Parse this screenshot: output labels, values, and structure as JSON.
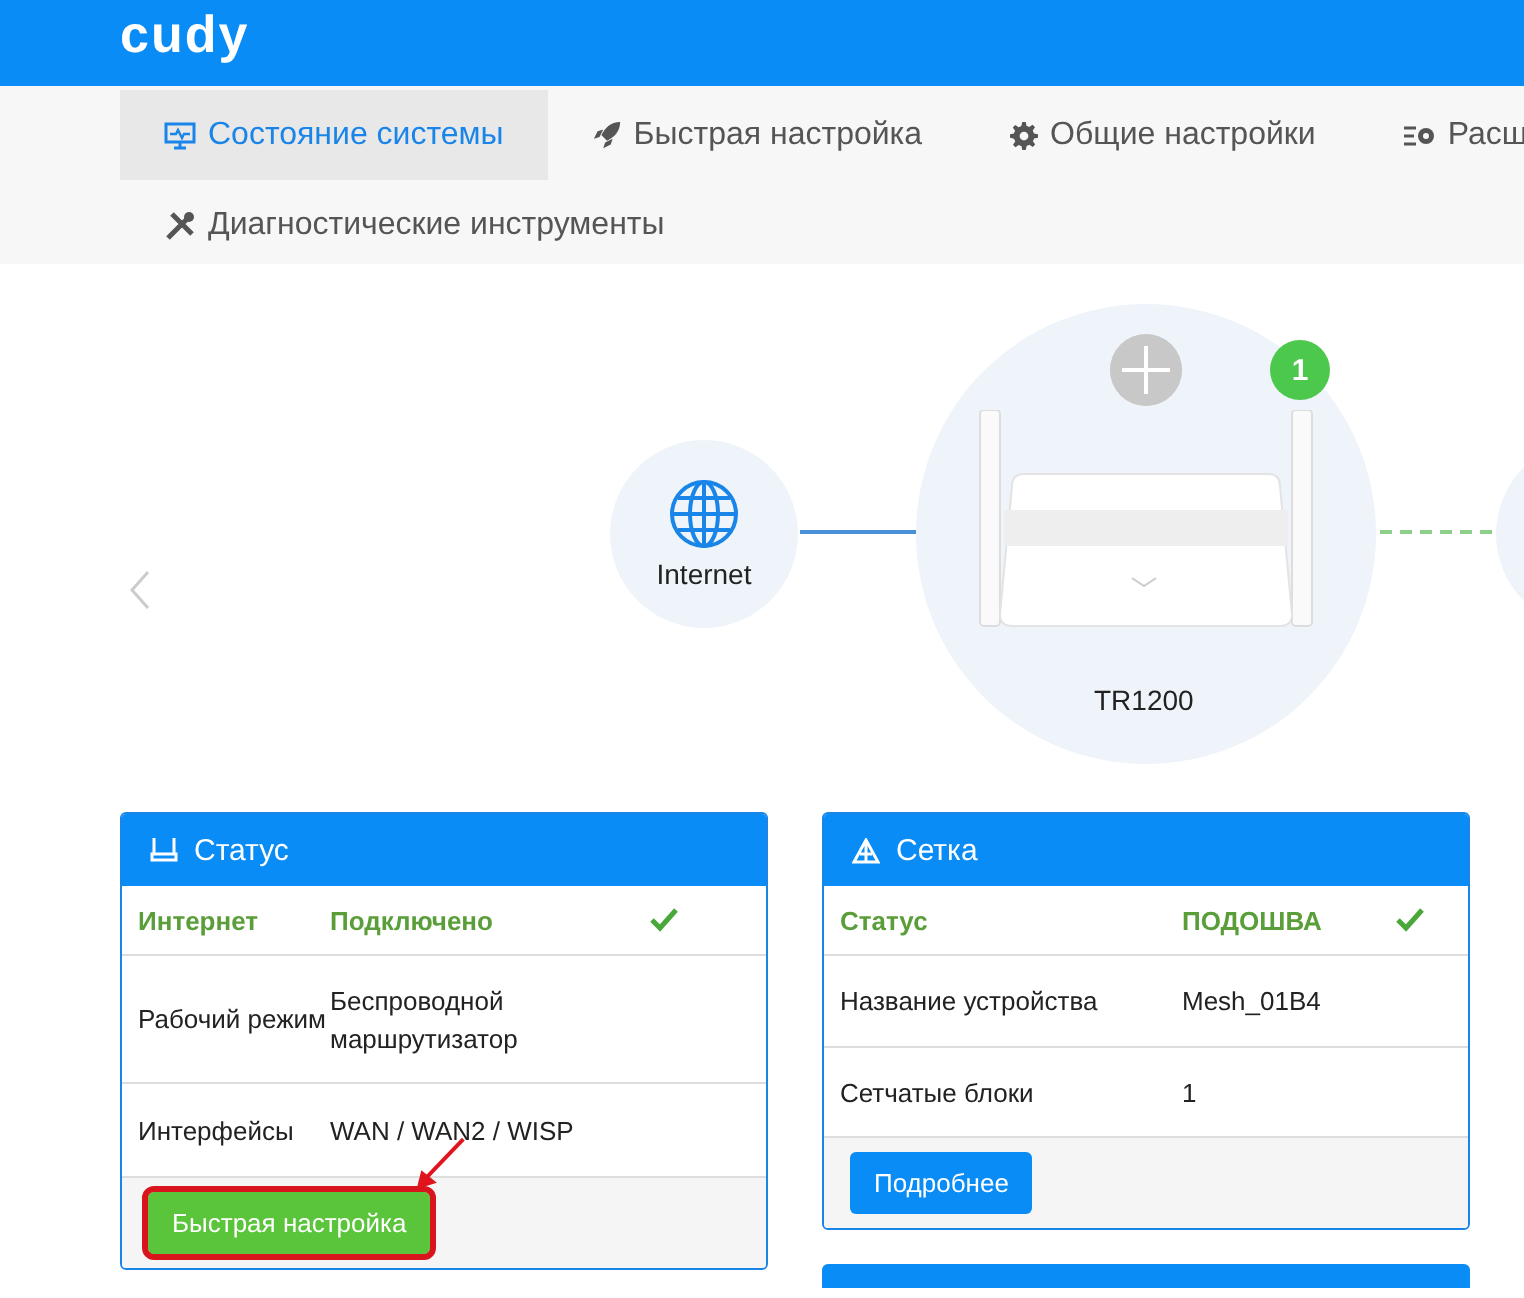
{
  "header": {
    "logo": "cudy"
  },
  "nav": {
    "tabs": [
      {
        "label": "Состояние системы",
        "selected": true
      },
      {
        "label": "Быстрая настройка",
        "selected": false
      },
      {
        "label": "Общие настройки",
        "selected": false
      },
      {
        "label": "Расш",
        "selected": false
      },
      {
        "label": "Диагностические инструменты",
        "selected": false
      }
    ]
  },
  "topology": {
    "internet": {
      "label": "Internet"
    },
    "router": {
      "label": "TR1200",
      "badge": "1"
    }
  },
  "cards": [
    {
      "title": "Статус",
      "rows": [
        {
          "label": "Интернет",
          "value": "Подключено",
          "ok": true
        },
        {
          "label": "Рабочий режим",
          "value": "Беспроводной маршрутизатор",
          "ok": false
        },
        {
          "label": "Интерфейсы",
          "value": "WAN / WAN2 / WISP",
          "ok": false
        }
      ],
      "button": {
        "label": "Быстрая настройка",
        "kind": "success",
        "highlighted": true
      }
    },
    {
      "title": "Сетка",
      "rows": [
        {
          "label": "Статус",
          "value": "ПОДОШВА",
          "ok": true
        },
        {
          "label": "Название устройства",
          "value": "Mesh_01B4",
          "ok": false
        },
        {
          "label": "Сетчатые блоки",
          "value": "1",
          "ok": false
        }
      ],
      "button": {
        "label": "Подробнее",
        "kind": "primary",
        "highlighted": false
      }
    }
  ]
}
